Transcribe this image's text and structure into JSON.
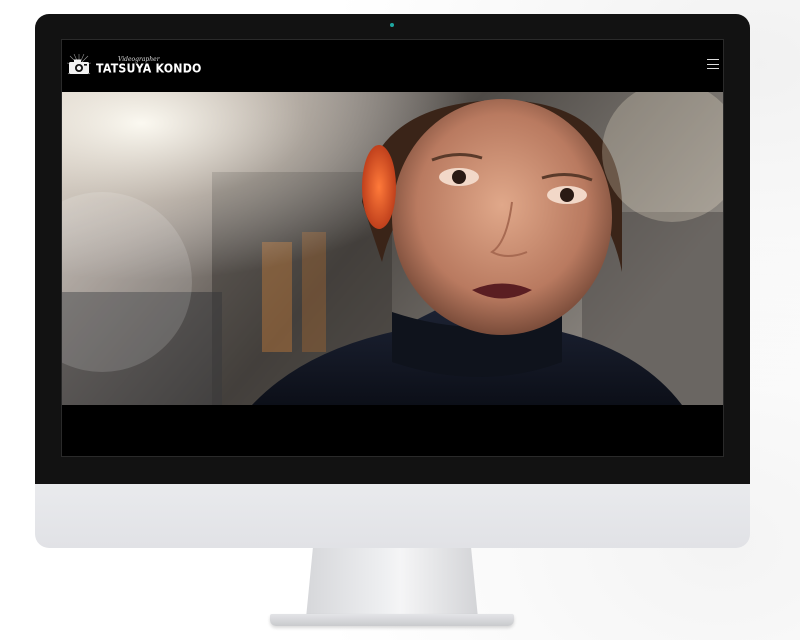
{
  "site": {
    "logo_subtitle": "Videographer",
    "logo_title": "TATSUYA KONDO"
  },
  "icons": {
    "logo": "camera-icon",
    "menu": "hamburger-menu-icon"
  },
  "hero": {
    "image": "portrait of a woman in a dark turtleneck with sunlit flare, blurred city background"
  },
  "colors": {
    "bezel": "#121212",
    "screen_bg": "#000000",
    "chin": "#e5e6e9",
    "camera_light": "#1ea7a0"
  }
}
